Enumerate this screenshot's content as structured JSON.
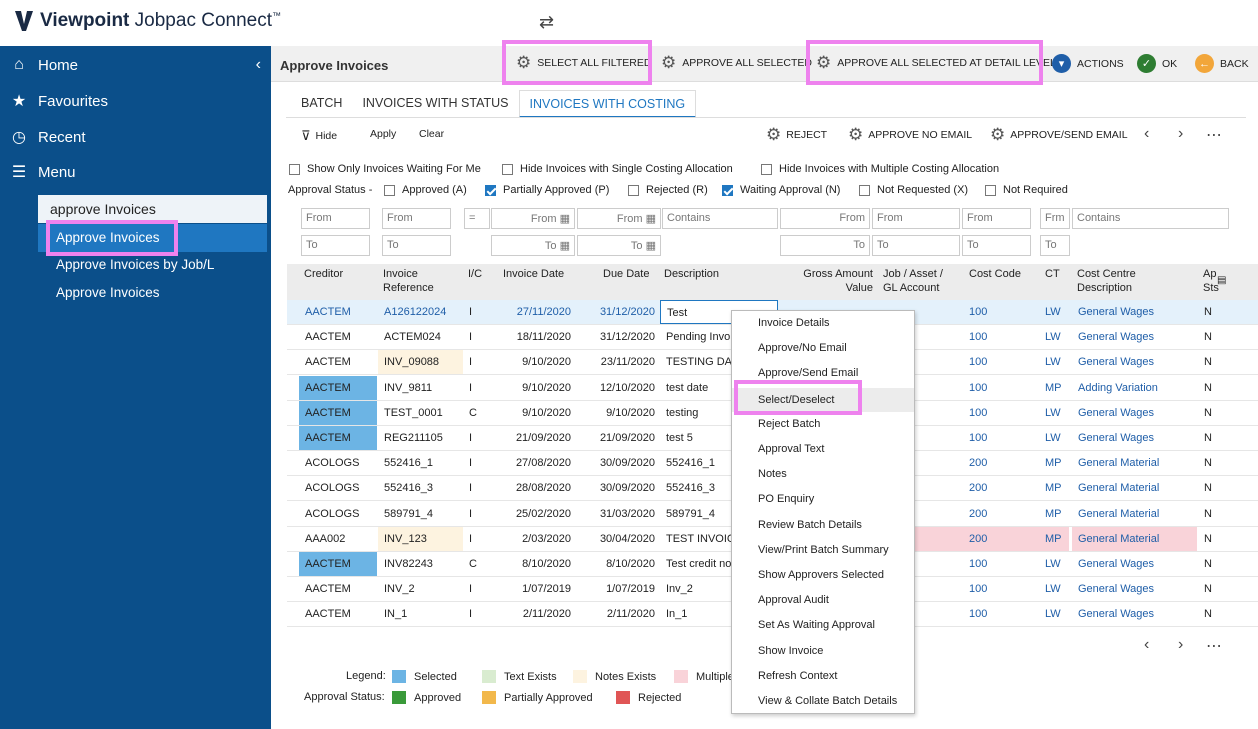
{
  "app": {
    "brand_bold": "Viewpoint",
    "brand_rest": "Jobpac Connect",
    "brand_tm": "™"
  },
  "sidebar": {
    "nav": [
      {
        "icon": "home-icon",
        "label": "Home"
      },
      {
        "icon": "star-icon",
        "label": "Favourites"
      },
      {
        "icon": "clock-icon",
        "label": "Recent"
      },
      {
        "icon": "menu-icon",
        "label": "Menu"
      }
    ],
    "search_value": "approve Invoices",
    "results": [
      "Approve Invoices",
      "Approve Invoices by Job/L",
      "Approve Invoices"
    ]
  },
  "page": {
    "title": "Approve Invoices"
  },
  "toolbar": {
    "select_all_filtered": "SELECT ALL FILTERED",
    "approve_all_selected": "APPROVE ALL SELECTED",
    "approve_all_detail": "APPROVE ALL SELECTED AT DETAIL LEVEL",
    "actions": "ACTIONS",
    "ok": "OK",
    "back": "BACK"
  },
  "tabs": [
    "BATCH",
    "INVOICES WITH STATUS",
    "INVOICES WITH COSTING"
  ],
  "filterbar": {
    "hide": "Hide",
    "apply": "Apply",
    "clear": "Clear",
    "reject": "REJECT",
    "approve_no_email": "APPROVE NO EMAIL",
    "approve_send_email": "APPROVE/SEND EMAIL"
  },
  "options": {
    "waiting_for_me": "Show Only Invoices Waiting For Me",
    "hide_single": "Hide Invoices with Single Costing Allocation",
    "hide_multiple": "Hide Invoices with Multiple Costing Allocation",
    "approval_status_label": "Approval Status -",
    "statuses": [
      {
        "label": "Approved (A)",
        "checked": false
      },
      {
        "label": "Partially Approved (P)",
        "checked": true
      },
      {
        "label": "Rejected (R)",
        "checked": false
      },
      {
        "label": "Waiting Approval (N)",
        "checked": true
      },
      {
        "label": "Not Requested (X)",
        "checked": false
      },
      {
        "label": "Not Required",
        "checked": false
      }
    ]
  },
  "filters": {
    "from": "From",
    "to": "To",
    "eq": "=",
    "contains": "Contains",
    "frm": "Frm"
  },
  "columns": [
    "Creditor",
    "Invoice Reference",
    "I/C",
    "Invoice Date",
    "Due Date",
    "Description",
    "Gross Amount Value",
    "Job / Asset / GL Account",
    "Cost Code",
    "CT",
    "Cost Centre Description",
    "Ap Sts"
  ],
  "rows": [
    {
      "creditor": "AACTEM",
      "ref": "A126122024",
      "ic": "I",
      "inv_date": "27/11/2020",
      "due": "31/12/2020",
      "desc": "Test",
      "gross": "",
      "job": "",
      "code": "100",
      "ct": "LW",
      "ccd": "General Wages",
      "sts": "N"
    },
    {
      "creditor": "AACTEM",
      "ref": "ACTEM024",
      "ic": "I",
      "inv_date": "18/11/2020",
      "due": "31/12/2020",
      "desc": "Pending Invo",
      "gross": "",
      "job": "",
      "code": "100",
      "ct": "LW",
      "ccd": "General Wages",
      "sts": "N"
    },
    {
      "creditor": "AACTEM",
      "ref": "INV_09088",
      "ic": "I",
      "inv_date": "9/10/2020",
      "due": "23/11/2020",
      "desc": "TESTING DAT",
      "gross": "",
      "job": "",
      "code": "100",
      "ct": "LW",
      "ccd": "General Wages",
      "sts": "N"
    },
    {
      "creditor": "AACTEM",
      "ref": "INV_9811",
      "ic": "I",
      "inv_date": "9/10/2020",
      "due": "12/10/2020",
      "desc": "test date",
      "gross": "",
      "job": "",
      "code": "100",
      "ct": "MP",
      "ccd": "Adding Variation",
      "sts": "N"
    },
    {
      "creditor": "AACTEM",
      "ref": "TEST_0001",
      "ic": "C",
      "inv_date": "9/10/2020",
      "due": "9/10/2020",
      "desc": "testing",
      "gross": "",
      "job": "",
      "code": "100",
      "ct": "LW",
      "ccd": "General Wages",
      "sts": "N"
    },
    {
      "creditor": "AACTEM",
      "ref": "REG211105",
      "ic": "I",
      "inv_date": "21/09/2020",
      "due": "21/09/2020",
      "desc": "test 5",
      "gross": "",
      "job": "",
      "code": "100",
      "ct": "LW",
      "ccd": "General Wages",
      "sts": "N"
    },
    {
      "creditor": "ACOLOGS",
      "ref": "552416_1",
      "ic": "I",
      "inv_date": "27/08/2020",
      "due": "30/09/2020",
      "desc": "552416_1",
      "gross": "",
      "job": "",
      "code": "200",
      "ct": "MP",
      "ccd": "General Material",
      "sts": "N"
    },
    {
      "creditor": "ACOLOGS",
      "ref": "552416_3",
      "ic": "I",
      "inv_date": "28/08/2020",
      "due": "30/09/2020",
      "desc": "552416_3",
      "gross": "",
      "job": "",
      "code": "200",
      "ct": "MP",
      "ccd": "General Material",
      "sts": "N"
    },
    {
      "creditor": "ACOLOGS",
      "ref": "589791_4",
      "ic": "I",
      "inv_date": "25/02/2020",
      "due": "31/03/2020",
      "desc": "589791_4",
      "gross": "",
      "job": "",
      "code": "200",
      "ct": "MP",
      "ccd": "General Material",
      "sts": "N"
    },
    {
      "creditor": "AAA002",
      "ref": "INV_123",
      "ic": "I",
      "inv_date": "2/03/2020",
      "due": "30/04/2020",
      "desc": "TEST INVOICE",
      "gross": "",
      "job": "",
      "code": "200",
      "ct": "MP",
      "ccd": "General Material",
      "sts": "N"
    },
    {
      "creditor": "AACTEM",
      "ref": "INV82243",
      "ic": "C",
      "inv_date": "8/10/2020",
      "due": "8/10/2020",
      "desc": "Test credit no",
      "gross": "",
      "job": "",
      "code": "100",
      "ct": "LW",
      "ccd": "General Wages",
      "sts": "N"
    },
    {
      "creditor": "AACTEM",
      "ref": "INV_2",
      "ic": "I",
      "inv_date": "1/07/2019",
      "due": "1/07/2019",
      "desc": "Inv_2",
      "gross": "",
      "job": "",
      "code": "100",
      "ct": "LW",
      "ccd": "General Wages",
      "sts": "N"
    },
    {
      "creditor": "AACTEM",
      "ref": "IN_1",
      "ic": "I",
      "inv_date": "2/11/2020",
      "due": "2/11/2020",
      "desc": "In_1",
      "gross": "",
      "job": "",
      "code": "100",
      "ct": "LW",
      "ccd": "General Wages",
      "sts": "N"
    }
  ],
  "context_menu": [
    "Invoice Details",
    "Approve/No Email",
    "Approve/Send Email",
    "Select/Deselect",
    "Reject Batch",
    "Approval Text",
    "Notes",
    "PO Enquiry",
    "Review Batch Details",
    "View/Print Batch Summary",
    "Show Approvers Selected",
    "Approval Audit",
    "Set As Waiting Approval",
    "Show Invoice",
    "Refresh Context",
    "View & Collate Batch Details"
  ],
  "legend": {
    "label": "Legend:",
    "selected": "Selected",
    "text_exists": "Text Exists",
    "notes_exists": "Notes Exists",
    "multiple": "Multiple",
    "status_label": "Approval Status:",
    "approved": "Approved",
    "partial": "Partially Approved",
    "rejected": "Rejected"
  },
  "colors": {
    "selected": "#6cb4e4",
    "text": "#d9ecd0",
    "notes": "#fdf3e0",
    "multiple": "#f9d3d9",
    "approved": "#3a9a3a",
    "partial": "#f2b84b",
    "rejected": "#e05555",
    "accent": "#1f77c1"
  }
}
